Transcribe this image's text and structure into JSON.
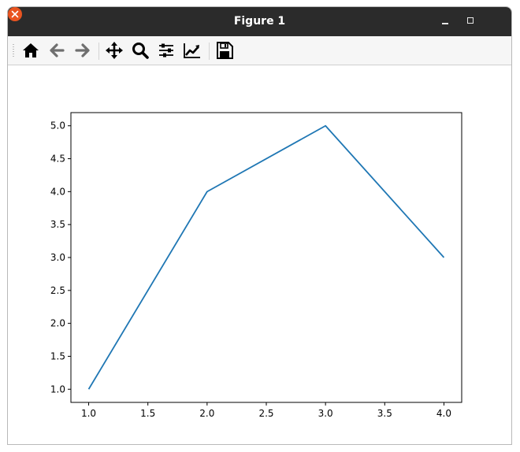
{
  "window": {
    "title": "Figure 1"
  },
  "toolbar": {
    "tools": [
      {
        "name": "home",
        "icon": "home-icon"
      },
      {
        "name": "back",
        "icon": "arrow-left-icon"
      },
      {
        "name": "forward",
        "icon": "arrow-right-icon"
      },
      {
        "name": "pan",
        "icon": "move-icon"
      },
      {
        "name": "zoom",
        "icon": "magnifier-icon"
      },
      {
        "name": "configure-subplots",
        "icon": "sliders-icon"
      },
      {
        "name": "edit-axis",
        "icon": "line-chart-icon"
      },
      {
        "name": "save",
        "icon": "floppy-disk-icon"
      }
    ]
  },
  "colors": {
    "titlebar": "#2b2b2b",
    "close": "#e95420",
    "line": "#1f77b4"
  },
  "chart_data": {
    "type": "line",
    "x": [
      1.0,
      2.0,
      3.0,
      4.0
    ],
    "series": [
      {
        "values": [
          1.0,
          4.0,
          5.0,
          3.0
        ]
      }
    ],
    "xlim": [
      0.85,
      4.15
    ],
    "ylim": [
      0.8,
      5.2
    ],
    "xticks": [
      "1.0",
      "1.5",
      "2.0",
      "2.5",
      "3.0",
      "3.5",
      "4.0"
    ],
    "yticks": [
      "1.0",
      "1.5",
      "2.0",
      "2.5",
      "3.0",
      "3.5",
      "4.0",
      "4.5",
      "5.0"
    ],
    "title": "",
    "xlabel": "",
    "ylabel": "",
    "grid": false
  }
}
